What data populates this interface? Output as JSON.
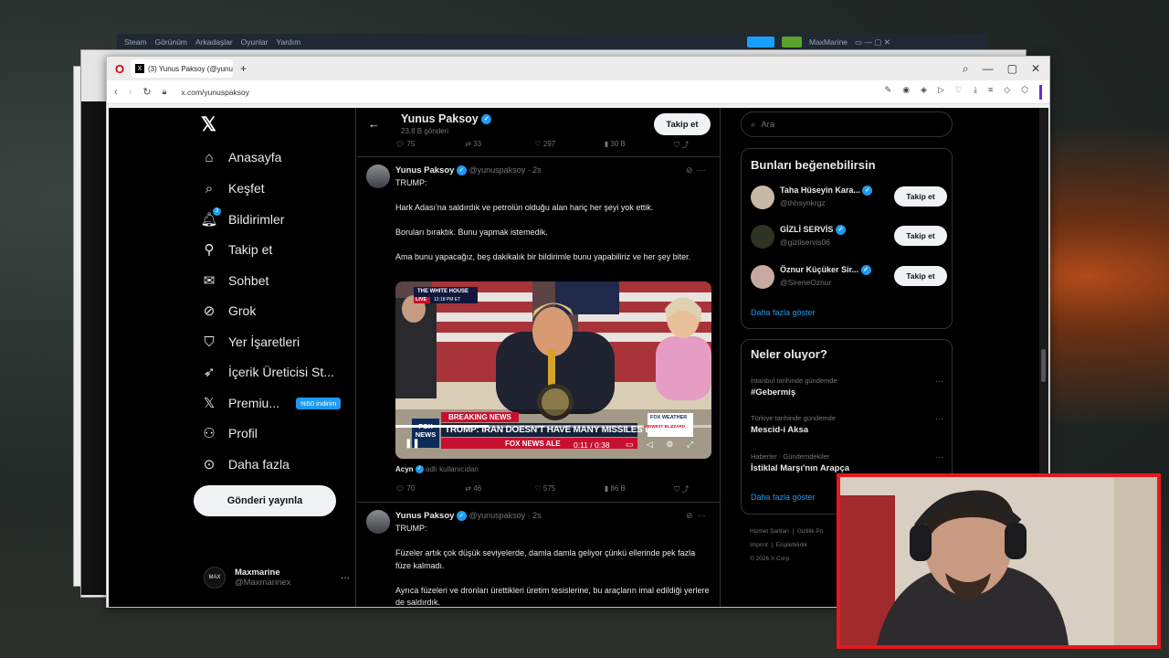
{
  "steam": {
    "menu": [
      "Steam",
      "Görünüm",
      "Arkadaşlar",
      "Oyunlar",
      "Yardım"
    ],
    "user": "MaxMarine"
  },
  "browser": {
    "tab_title": "(3) Yunus Paksoy (@yunus",
    "url": "x.com/yunuspaksoy"
  },
  "nav": {
    "items": [
      "Anasayfa",
      "Keşfet",
      "Bildirimler",
      "Takip et",
      "Sohbet",
      "Grok",
      "Yer İşaretleri",
      "İçerik Üreticisi St...",
      "Premiu...",
      "Profil",
      "Daha fazla"
    ],
    "notif_count": "3",
    "premium_badge": "%50 indirim",
    "post_button": "Gönderi yayınla",
    "account_name": "Maxmarine",
    "account_handle": "@Maxmarinex"
  },
  "profile": {
    "name": "Yunus Paksoy",
    "posts_count": "23,8 B gönderi",
    "follow": "Takip et"
  },
  "prev_stats": [
    "75",
    "33",
    "297",
    "30 B"
  ],
  "tweets": [
    {
      "name": "Yunus Paksoy",
      "handle": "@yunuspaksoy",
      "time": "· 2s",
      "paragraphs": [
        "TRUMP:",
        "Hark Adası'na saldırdık ve petrolün olduğu alan hariç her şeyi yok ettik.",
        "Boruları bıraktık. Bunu yapmak istemedik.",
        "Ama bunu yapacağız, beş dakikalık bir bildirimle bunu yapabiliriz ve her şey biter."
      ],
      "video": {
        "source_tag": "THE WHITE HOUSE",
        "live": "LIVE",
        "clock": "12:18 PM ET",
        "breaking": "BREAKING NEWS",
        "headline": "TRUMP: IRAN DOESN'T HAVE MANY MISSILES LEFT",
        "ticker": "FOX NEWS ALE",
        "channel": "FOX NEWS",
        "weather_tag": "FOX WEATHER",
        "weather_text": "MIDWEST BLIZZARD",
        "time": "0:11 / 0:38"
      },
      "credit_name": "Acyn",
      "credit_suffix": "adlı kullanıcıdan",
      "stats": [
        "70",
        "46",
        "575",
        "86 B"
      ]
    },
    {
      "name": "Yunus Paksoy",
      "handle": "@yunuspaksoy",
      "time": "· 2s",
      "paragraphs": [
        "TRUMP:",
        "Füzeler artık çok düşük seviyelerde, damla damla geliyor çünkü ellerinde pek fazla füze kalmadı.",
        "Ayrıca füzeleri ve dronları ürettikleri üretim tesislerine, bu araçların imal edildiği yerlere de saldırdık."
      ]
    }
  ],
  "right": {
    "search_placeholder": "Ara",
    "who_title": "Bunları beğenebilirsin",
    "who": [
      {
        "name": "Taha Hüseyin Kara...",
        "handle": "@thhsynkrgz",
        "color": "#c9b8a6"
      },
      {
        "name": "GİZLİ SERVİS",
        "handle": "@gizliservis06",
        "color": "#2f3322"
      },
      {
        "name": "Öznur Küçüker Sir...",
        "handle": "@SireneOznur",
        "color": "#c7a9a0"
      }
    ],
    "follow_label": "Takip et",
    "show_more": "Daha fazla göster",
    "trends_title": "Neler oluyor?",
    "trends": [
      {
        "context": "İstanbul tarihinde gündemde",
        "topic": "#Gebermiş"
      },
      {
        "context": "Türkiye tarihinde gündemde",
        "topic": "Mescid-i Aksa"
      },
      {
        "context": "Haberler · Gündemdekiler",
        "topic": "İstiklal Marşı'nın Arapça"
      }
    ],
    "footer": [
      "Hizmet Şartları",
      "Gizlilik Po",
      "Imprint",
      "Erişilebilirlik",
      "© 2026 X Corp."
    ]
  }
}
